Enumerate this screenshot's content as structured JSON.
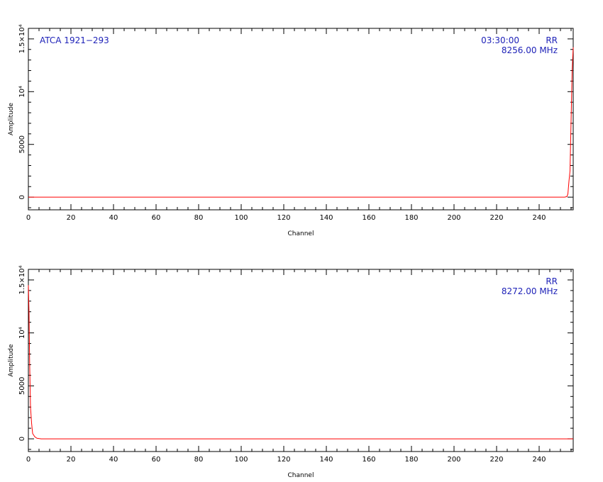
{
  "chart_data": [
    {
      "type": "line",
      "xlabel": "Channel",
      "ylabel": "Amplitude",
      "xlim": [
        0,
        256
      ],
      "ylim": [
        -1200,
        16000
      ],
      "x_ticks": [
        "0",
        "20",
        "40",
        "60",
        "80",
        "100",
        "120",
        "140",
        "160",
        "180",
        "200",
        "220",
        "240"
      ],
      "y_ticks": [
        {
          "label": "0",
          "value": 0
        },
        {
          "label": "5000",
          "value": 5000
        },
        {
          "label": "10⁴",
          "value": 10000
        },
        {
          "label": "1.5×10⁴",
          "value": 15000
        }
      ],
      "annotations": {
        "left": "ATCA 1921−293",
        "time": "03:30:00",
        "pol": "RR",
        "freq": "8256.00 MHz"
      },
      "series": [
        {
          "color": "#ff0000",
          "x": [
            0,
            250,
            252,
            253,
            253.5,
            254,
            254.5,
            255,
            255.5,
            256
          ],
          "y": [
            0,
            0,
            0,
            50,
            300,
            1500,
            2500,
            7200,
            12000,
            14200
          ]
        }
      ]
    },
    {
      "type": "line",
      "xlabel": "Channel",
      "ylabel": "Amplitude",
      "xlim": [
        0,
        256
      ],
      "ylim": [
        -1200,
        16000
      ],
      "x_ticks": [
        "0",
        "20",
        "40",
        "60",
        "80",
        "100",
        "120",
        "140",
        "160",
        "180",
        "200",
        "220",
        "240"
      ],
      "y_ticks": [
        {
          "label": "0",
          "value": 0
        },
        {
          "label": "5000",
          "value": 5000
        },
        {
          "label": "10⁴",
          "value": 10000
        },
        {
          "label": "1.5×10⁴",
          "value": 15000
        }
      ],
      "annotations": {
        "left": "",
        "time": "",
        "pol": "RR",
        "freq": "8272.00 MHz"
      },
      "series": [
        {
          "color": "#ff0000",
          "x": [
            0,
            0.3,
            0.6,
            1,
            1.5,
            2,
            3,
            4,
            6,
            10,
            256
          ],
          "y": [
            14500,
            12000,
            7200,
            3000,
            1500,
            500,
            200,
            50,
            0,
            0,
            0
          ]
        }
      ]
    }
  ]
}
